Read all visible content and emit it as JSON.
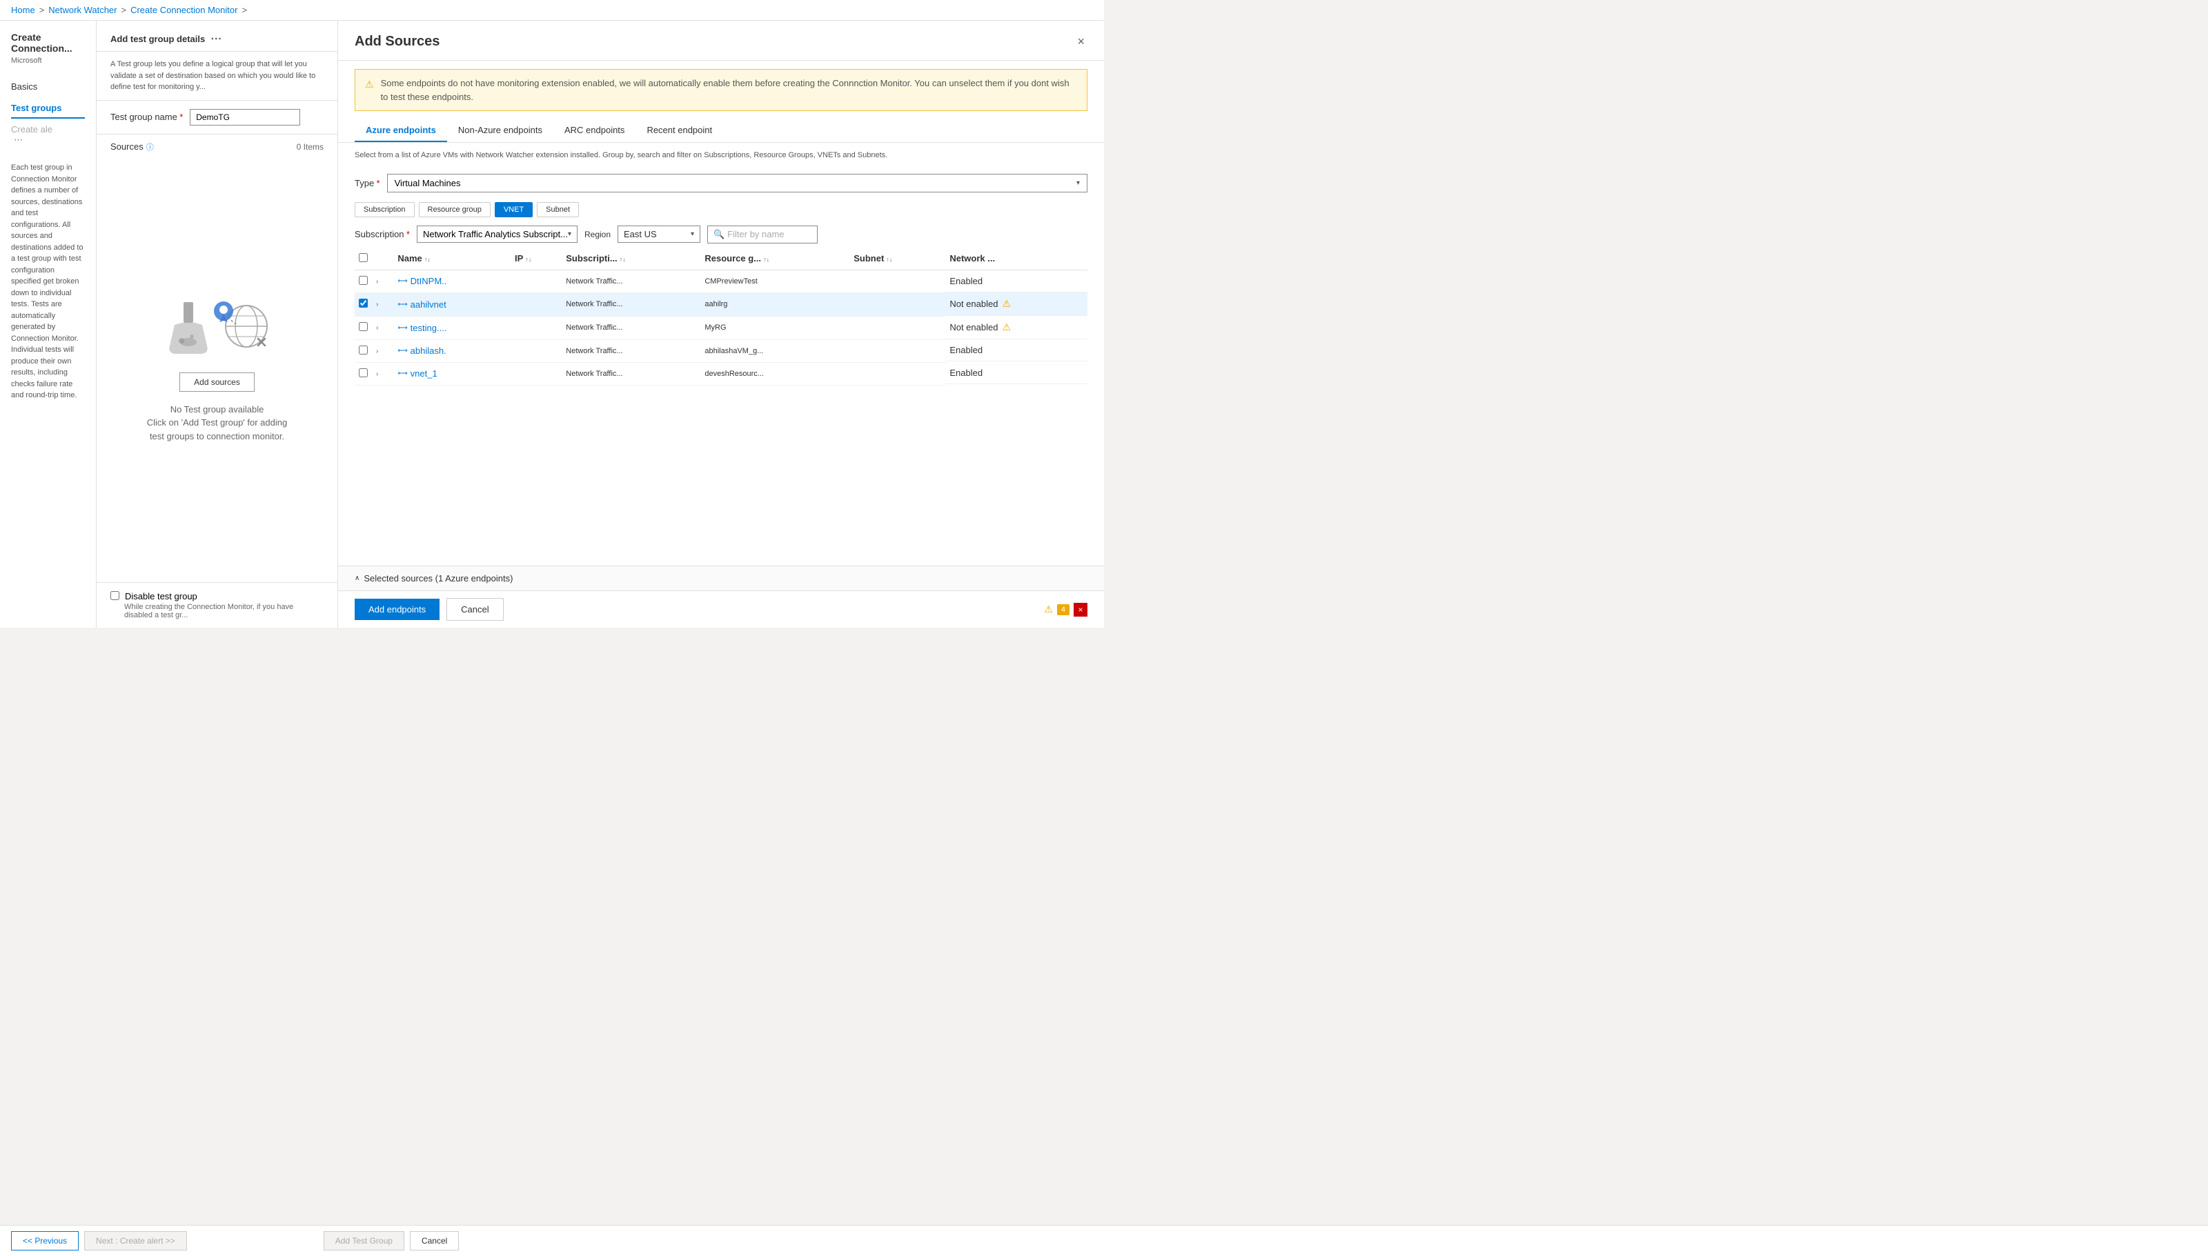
{
  "breadcrumb": {
    "items": [
      "Home",
      "Network Watcher",
      "Create Connection Monitor"
    ],
    "separators": [
      ">",
      ">",
      ">"
    ]
  },
  "sidebar": {
    "title": "Create Connection...",
    "subtitle": "Microsoft",
    "nav_items": [
      {
        "label": "Basics",
        "state": "normal"
      },
      {
        "label": "Test groups",
        "state": "active"
      },
      {
        "label": "Create ale",
        "state": "disabled"
      }
    ],
    "description": "Each test group in Connection Monitor defines a number of sources, destinations and test configurations. All sources and destinations added to a test group with test configuration specified get broken down to individual tests. Tests are automatically generated by Connection Monitor. Individual tests will produce their own results, including checks failure rate and round-trip time.",
    "more_icon": "⋯"
  },
  "center_panel": {
    "title": "Add test group details",
    "more_icon": "⋯",
    "description": "A Test group lets you define a logical group that will let you validate a set of destination based on which you would like to define test for monitoring y...",
    "test_group_name": {
      "label": "Test group name",
      "required": true,
      "value": "DemoTG"
    },
    "sources": {
      "label": "Sources",
      "info": true,
      "count": "0 Items",
      "empty_text_line1": "No Test group available",
      "empty_text_line2": "Click on 'Add Test group' for adding",
      "empty_text_line3": "test groups to connection monitor.",
      "add_sources_btn": "Add sources"
    },
    "disable_group": {
      "label": "Disable test group",
      "description": "While creating the Connection Monitor, if you have disabled a test gr..."
    },
    "bottom_buttons": {
      "previous": "<< Previous",
      "next": "Next : Create alert >>",
      "add_test_group": "Add Test Group",
      "cancel": "Cancel"
    }
  },
  "right_panel": {
    "title": "Add Sources",
    "close_btn": "×",
    "warning": "Some endpoints do not have monitoring extension enabled, we will automatically enable them before creating the Connnction Monitor. You can unselect them if you dont wish to test these endpoints.",
    "tabs": [
      {
        "label": "Azure endpoints",
        "active": true
      },
      {
        "label": "Non-Azure endpoints",
        "active": false
      },
      {
        "label": "ARC endpoints",
        "active": false
      },
      {
        "label": "Recent endpoint",
        "active": false
      }
    ],
    "description": "Select from a list of Azure VMs with Network Watcher extension installed. Group by, search and filter on Subscriptions, Resource Groups, VNETs and Subnets.",
    "type_filter": {
      "label": "Type",
      "required": true,
      "value": "Virtual Machines"
    },
    "group_chips": [
      {
        "label": "Subscription",
        "active": false
      },
      {
        "label": "Resource group",
        "active": false
      },
      {
        "label": "VNET",
        "active": true
      },
      {
        "label": "Subnet",
        "active": false
      }
    ],
    "subscription": {
      "label": "Subscription",
      "required": true,
      "value": "Network Traffic Analytics Subscript..."
    },
    "region": {
      "label": "Region",
      "value": "East US"
    },
    "filter_placeholder": "Filter by name",
    "table": {
      "columns": [
        {
          "label": "Name",
          "sortable": true
        },
        {
          "label": "IP",
          "sortable": true
        },
        {
          "label": "Subscripti...",
          "sortable": true
        },
        {
          "label": "Resource g...",
          "sortable": true
        },
        {
          "label": "Subnet",
          "sortable": true
        },
        {
          "label": "Network ...",
          "sortable": false
        }
      ],
      "rows": [
        {
          "selected": false,
          "name": "DtINPM..",
          "ip": "",
          "subscription": "Network Traffic...",
          "resource_group": "CMPreviewTest",
          "subnet": "",
          "network_watcher": "Enabled",
          "warning": false
        },
        {
          "selected": true,
          "name": "aahilvnet",
          "ip": "",
          "subscription": "Network Traffic...",
          "resource_group": "aahilrg",
          "subnet": "",
          "network_watcher": "Not enabled",
          "warning": true
        },
        {
          "selected": false,
          "name": "testing....",
          "ip": "",
          "subscription": "Network Traffic...",
          "resource_group": "MyRG",
          "subnet": "",
          "network_watcher": "Not enabled",
          "warning": true
        },
        {
          "selected": false,
          "name": "abhilash.",
          "ip": "",
          "subscription": "Network Traffic...",
          "resource_group": "abhilashaVM_g...",
          "subnet": "",
          "network_watcher": "Enabled",
          "warning": false
        },
        {
          "selected": false,
          "name": "vnet_1",
          "ip": "",
          "subscription": "Network Traffic...",
          "resource_group": "deveshResourc...",
          "subnet": "",
          "network_watcher": "Enabled",
          "warning": false
        }
      ]
    },
    "selected_sources": "Selected sources (1 Azure endpoints)",
    "bottom_buttons": {
      "add_endpoints": "Add endpoints",
      "cancel": "Cancel"
    },
    "notification": {
      "warning_count": "4",
      "error_icon": "×"
    }
  }
}
